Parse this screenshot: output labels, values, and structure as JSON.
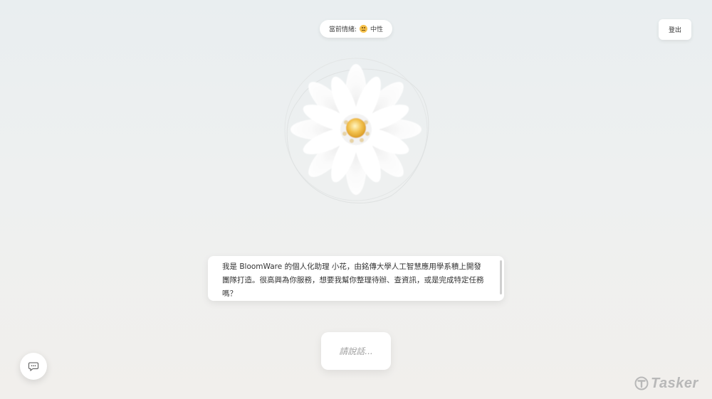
{
  "header": {
    "emotion_label": "當前情緒:",
    "emotion_icon": "neutral-face-icon",
    "emotion_value": "中性",
    "logout_label": "登出"
  },
  "assistant": {
    "message": "我是 BloomWare 的個人化助理 小花，由銘傳大學人工智慧應用學系積上開發團隊打造。很高興為你服務，想要我幫你整理待辦、查資訊，或是完成特定任務嗎？"
  },
  "input": {
    "placeholder": "請說話..."
  },
  "chat_fab": {
    "icon": "chat-bubble-icon"
  },
  "watermark": {
    "text": "Tasker"
  },
  "colors": {
    "flower_center": "#f2c14e",
    "petal": "#ffffff",
    "accent_text": "#333333"
  }
}
